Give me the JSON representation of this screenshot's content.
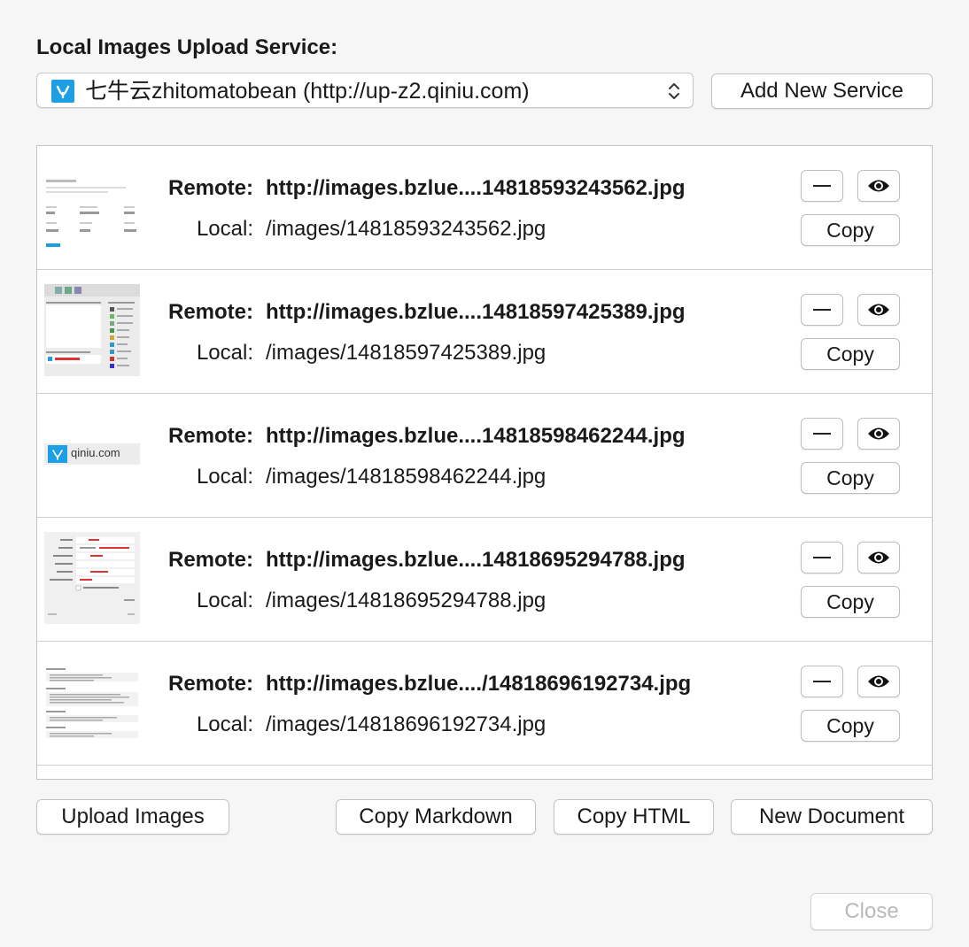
{
  "header": {
    "title": "Local Images Upload Service:"
  },
  "service": {
    "selected": "七牛云zhitomatobean (http://up-z2.qiniu.com)",
    "icon": "qiniu-logo-icon"
  },
  "buttons": {
    "add_service": "Add New Service",
    "upload": "Upload Images",
    "copy_markdown": "Copy Markdown",
    "copy_html": "Copy HTML",
    "new_document": "New Document",
    "close": "Close"
  },
  "labels": {
    "remote": "Remote:",
    "local": "Local:",
    "copy": "Copy"
  },
  "images": [
    {
      "remote": "http://images.bzlue....14818593243562.jpg",
      "local": "/images/14818593243562.jpg"
    },
    {
      "remote": "http://images.bzlue....14818597425389.jpg",
      "local": "/images/14818597425389.jpg"
    },
    {
      "remote": "http://images.bzlue....14818598462244.jpg",
      "local": "/images/14818598462244.jpg",
      "thumb_text": "qiniu.com"
    },
    {
      "remote": "http://images.bzlue....14818695294788.jpg",
      "local": "/images/14818695294788.jpg"
    },
    {
      "remote": "http://images.bzlue..../14818696192734.jpg",
      "local": "/images/14818696192734.jpg"
    }
  ],
  "colors": {
    "accent": "#1e9fe3",
    "background": "#f6f6f6"
  }
}
